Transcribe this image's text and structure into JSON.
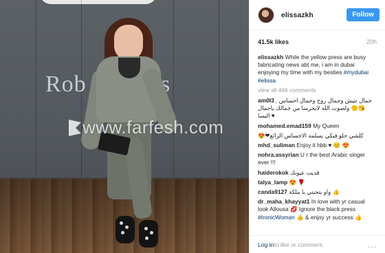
{
  "post": {
    "username": "elissazkh",
    "follow_label": "Follow",
    "likes": "41.5k likes",
    "time": "20h",
    "caption_user": "elissazkh",
    "caption_text": "While the yellow press are busy fabricating news abt me, i am in dubai enjoying my time with my besties",
    "caption_tags": "#mydubai #elissa",
    "view_all": "view all 466 comments"
  },
  "photo": {
    "sign_left": "Rob",
    "sign_right": "s",
    "watermark": "www.farfesh.com"
  },
  "comments": [
    {
      "user": "am0l3_",
      "text": "جمال نتيش وجمال روح وجمال احساس 😘🙂 ولصوت الله لايحرمنا من جمالك ياجمال اليسا ♥"
    },
    {
      "user": "mohamed.emad159",
      "text": "My Queen"
    },
    {
      "user": "",
      "text": "كلشي حلو فيكي بسلمه الاحساس الرائع❤😍"
    },
    {
      "user": "mhd_suliman",
      "text": "Enjoy it hbb ♥ 😊 😍"
    },
    {
      "user": "nohra.assyrian",
      "text": "U r the best Arabic singer ever !!!"
    },
    {
      "user": "haiderokok",
      "text": "قديت عيونك"
    },
    {
      "user": "talya_lamp",
      "text": "😍 🌹"
    },
    {
      "user": "canda9127",
      "text": "واو بتجنني يا ملكة 👍"
    },
    {
      "user": "dr_maha_khayyat1",
      "text": "In love with yr casual look Allousa 💋 Ignore the black press",
      "tag": "#IronicWoman",
      "tail": "👍 & enjoy yr success 👍"
    }
  ],
  "footer": {
    "login": "Log in",
    "rest": " to like or comment.",
    "more": "..."
  }
}
